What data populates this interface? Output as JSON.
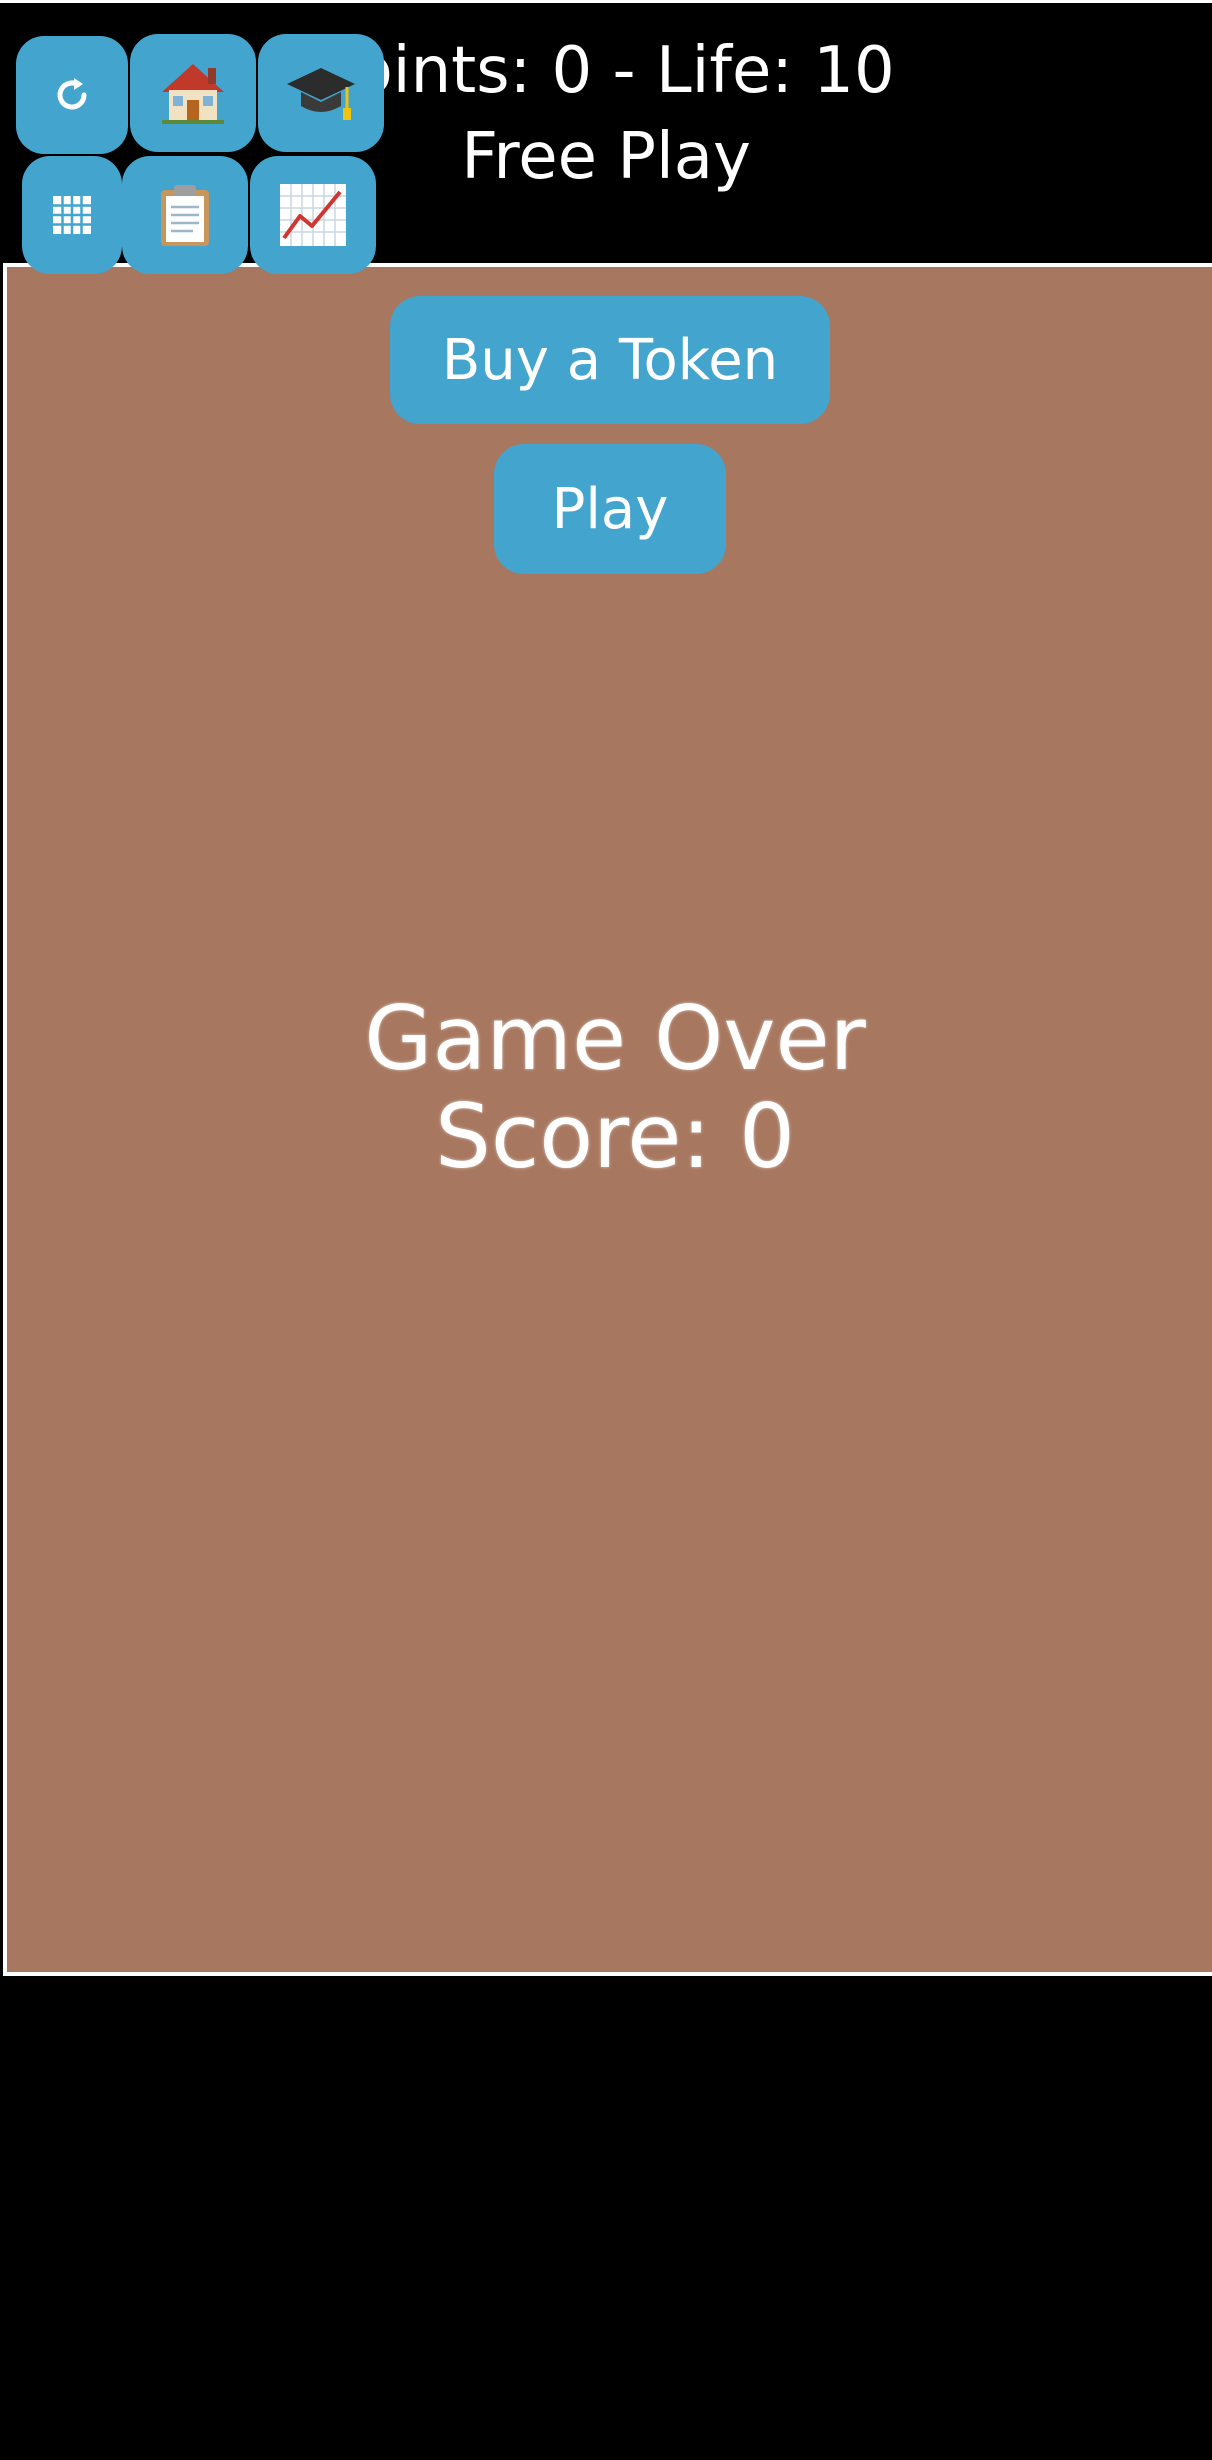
{
  "header": {
    "points_line": "Points: 0 - Life: 10",
    "mode": "Free Play"
  },
  "toolbar": {
    "buttons": [
      {
        "icon": "refresh-icon"
      },
      {
        "icon": "home-icon"
      },
      {
        "icon": "graduation-cap-icon"
      },
      {
        "icon": "grid-icon"
      },
      {
        "icon": "clipboard-icon"
      },
      {
        "icon": "chart-icon"
      }
    ]
  },
  "board": {
    "buy_token_label": "Buy a Token",
    "play_label": "Play",
    "game_over_label": "Game Over",
    "score_label": "Score: 0"
  },
  "colors": {
    "accent": "#43a4cd",
    "board": "#a8775f",
    "background": "#000000"
  }
}
